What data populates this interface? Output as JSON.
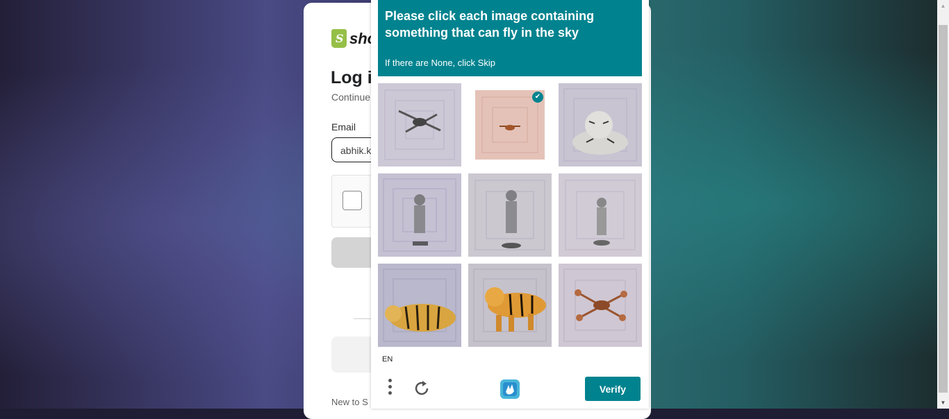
{
  "login": {
    "logo_text": "sho",
    "title": "Log i",
    "subtitle": "Continue",
    "email_label": "Email",
    "email_value": "abhik.k",
    "footer_text": "New to S"
  },
  "captcha": {
    "prompt": "Please click each image containing something that can fly in the sky",
    "hint": "If there are None, click Skip",
    "language": "EN",
    "verify_label": "Verify",
    "accent_color": "#00838f",
    "tiles": [
      {
        "subject": "drone",
        "selected": false
      },
      {
        "subject": "drone",
        "selected": true
      },
      {
        "subject": "tiger figurine",
        "selected": false
      },
      {
        "subject": "toy soldier figurine",
        "selected": false
      },
      {
        "subject": "toy soldier figurine",
        "selected": false
      },
      {
        "subject": "toy soldier figurine",
        "selected": false
      },
      {
        "subject": "tiger figurine",
        "selected": false
      },
      {
        "subject": "tiger figurine",
        "selected": false
      },
      {
        "subject": "drone",
        "selected": false
      }
    ]
  }
}
